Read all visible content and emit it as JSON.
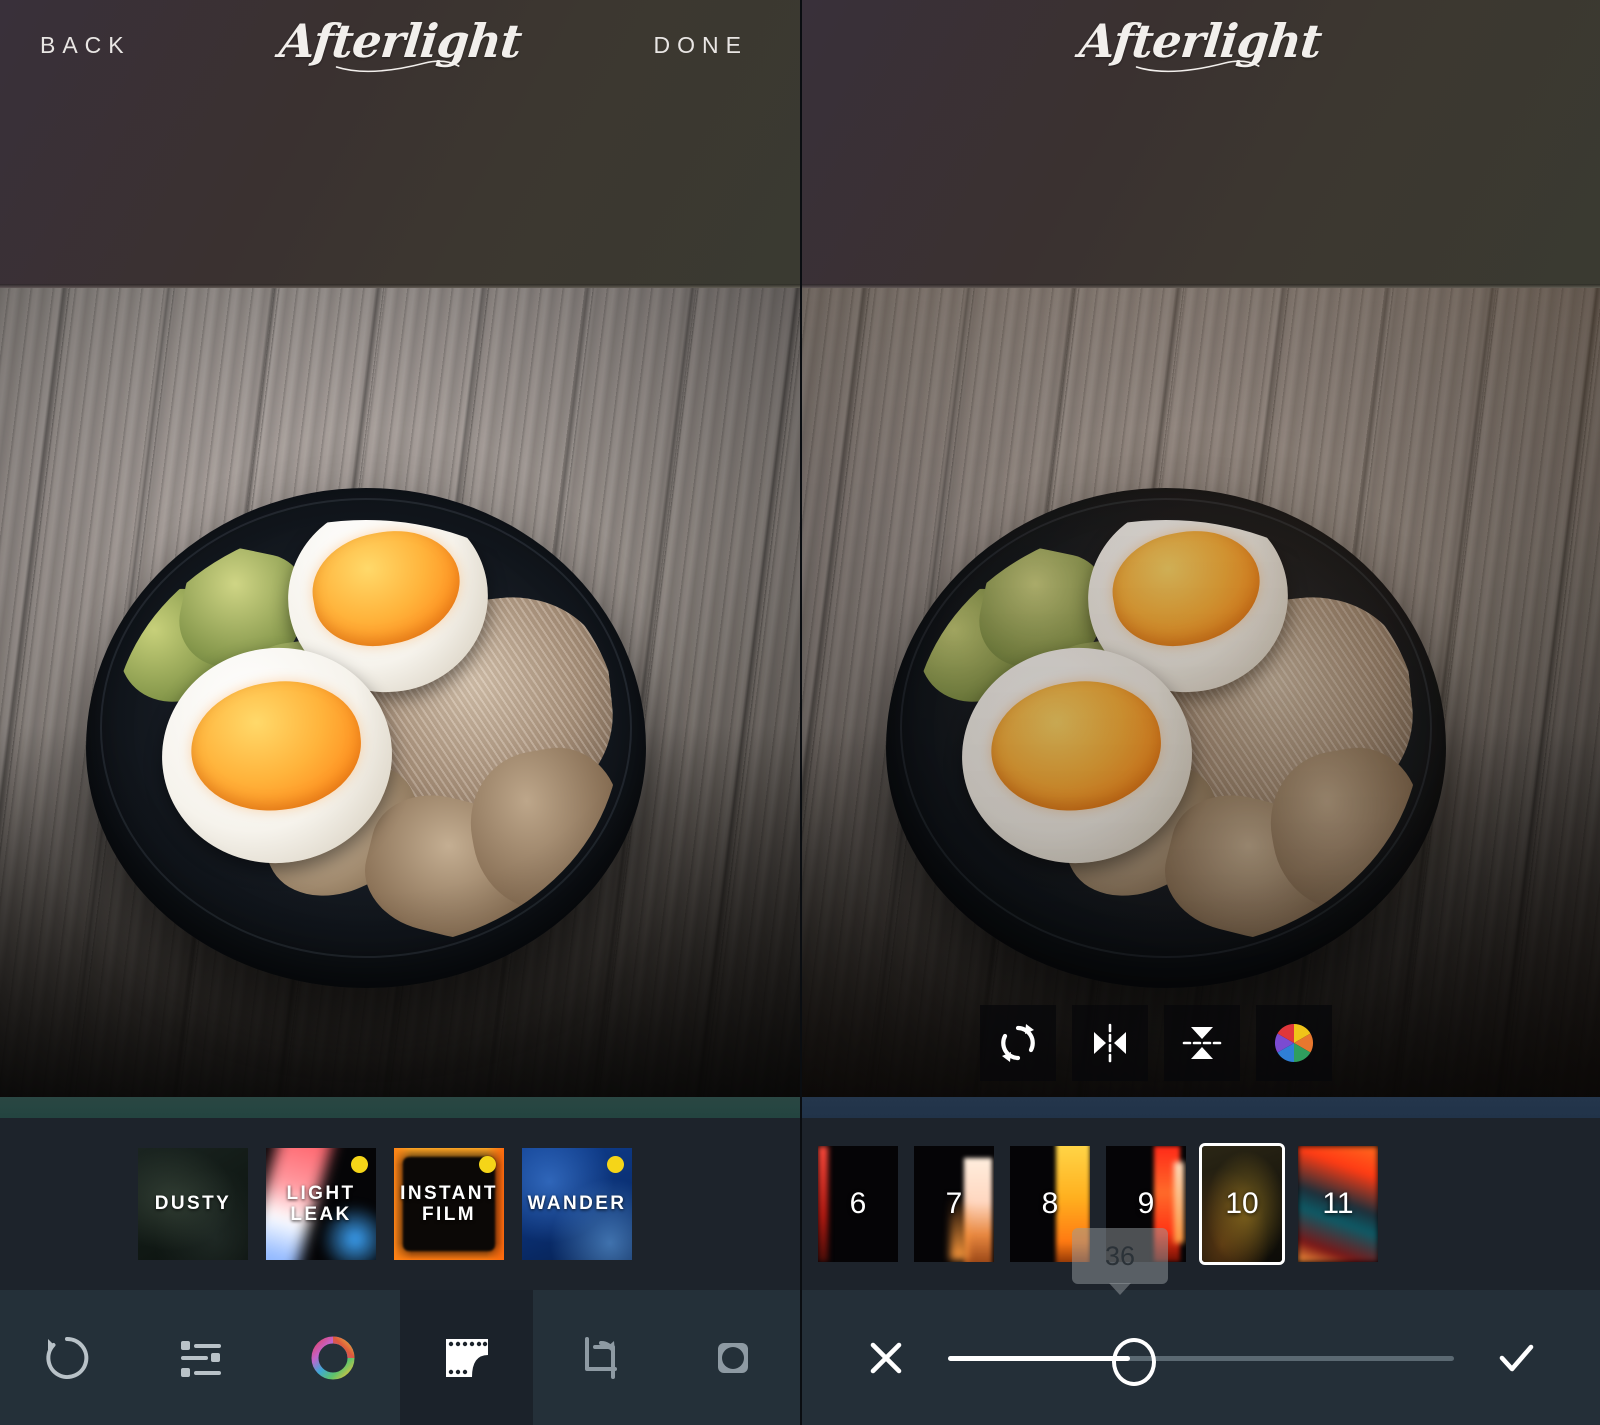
{
  "app": {
    "name": "Afterlight",
    "logo_text": "Afterlight"
  },
  "left_panel": {
    "header": {
      "back_label": "BACK",
      "title": "Afterlight",
      "done_label": "DONE"
    },
    "filter_strip": {
      "items": [
        {
          "label": "DUSTY",
          "label_line1": "DUSTY",
          "label_line2": "",
          "badge": false,
          "style": "bg-dusty"
        },
        {
          "label": "LIGHT LEAK",
          "label_line1": "LIGHT",
          "label_line2": "LEAK",
          "badge": true,
          "style": "bg-leak"
        },
        {
          "label": "INSTANT FILM",
          "label_line1": "INSTANT",
          "label_line2": "FILM",
          "badge": true,
          "style": "bg-instant"
        },
        {
          "label": "WANDER",
          "label_line1": "WANDER",
          "label_line2": "",
          "badge": true,
          "style": "bg-wander"
        }
      ],
      "badge_color": "#f5d518"
    },
    "toolbar": {
      "items": [
        {
          "name": "reset-icon",
          "label": "Reset",
          "active": false
        },
        {
          "name": "adjust-icon",
          "label": "Adjust",
          "active": false
        },
        {
          "name": "color-wheel-icon",
          "label": "Color",
          "active": false
        },
        {
          "name": "film-icon",
          "label": "Filters",
          "active": true
        },
        {
          "name": "crop-icon",
          "label": "Crop",
          "active": false
        },
        {
          "name": "frame-icon",
          "label": "Frame",
          "active": false
        }
      ]
    }
  },
  "right_panel": {
    "header": {
      "title": "Afterlight"
    },
    "image_tools": [
      {
        "name": "rotate-icon",
        "label": "Rotate"
      },
      {
        "name": "flip-horizontal-icon",
        "label": "Flip Horizontal"
      },
      {
        "name": "flip-vertical-icon",
        "label": "Flip Vertical"
      },
      {
        "name": "color-wheel-icon",
        "label": "Color"
      }
    ],
    "filter_strip": {
      "items": [
        {
          "number": "6",
          "selected": false,
          "style": "nb6"
        },
        {
          "number": "7",
          "selected": false,
          "style": "nb7"
        },
        {
          "number": "8",
          "selected": false,
          "style": "nb8"
        },
        {
          "number": "9",
          "selected": false,
          "style": "nb9"
        },
        {
          "number": "10",
          "selected": true,
          "style": "nb10"
        },
        {
          "number": "11",
          "selected": false,
          "style": "nb11"
        }
      ]
    },
    "slider": {
      "value": "36",
      "value_number": 36,
      "min": 0,
      "max": 100,
      "percent": 36,
      "cancel_label": "✕",
      "confirm_label": "✓"
    }
  },
  "colors": {
    "topbar": "#3a3130",
    "strip_bg": "#1d232b",
    "toolbar_bg": "#243039",
    "toolbar_active_bg": "#1b222a",
    "accent_white": "#ffffff",
    "badge_yellow": "#f5d518",
    "slider_track": "#5b6972"
  }
}
